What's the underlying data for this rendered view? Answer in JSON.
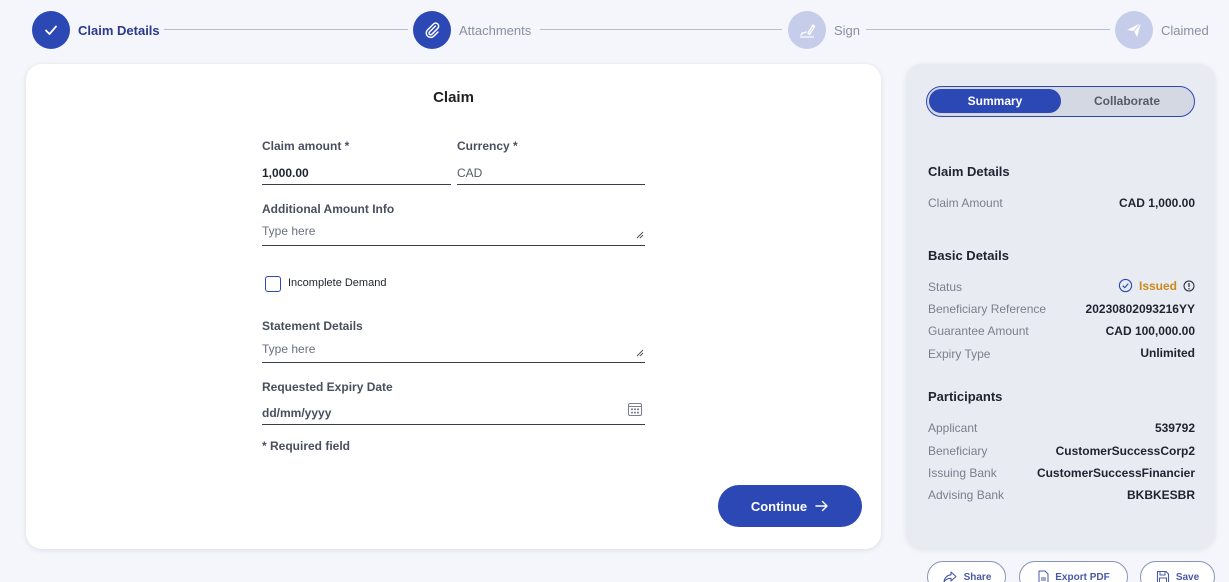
{
  "stepper": {
    "steps": [
      {
        "label": "Claim Details",
        "state": "done"
      },
      {
        "label": "Attachments",
        "state": "current"
      },
      {
        "label": "Sign",
        "state": "todo"
      },
      {
        "label": "Claimed",
        "state": "todo"
      }
    ]
  },
  "form": {
    "title": "Claim",
    "claim_amount_label": "Claim amount *",
    "claim_amount_value": "1,000.00",
    "currency_label": "Currency *",
    "currency_value": "CAD",
    "additional_info_label": "Additional Amount Info",
    "additional_info_placeholder": "Type here",
    "incomplete_demand_label": "Incomplete Demand",
    "statement_label": "Statement Details",
    "statement_placeholder": "Type here",
    "expiry_label": "Requested Expiry Date",
    "expiry_placeholder": "dd/mm/yyyy",
    "required_note": "* Required field",
    "continue_label": "Continue"
  },
  "summary": {
    "tabs": [
      "Summary",
      "Collaborate"
    ],
    "claim_details_title": "Claim Details",
    "claim_amount_label": "Claim Amount",
    "claim_amount_value": "CAD 1,000.00",
    "basic_details_title": "Basic Details",
    "status_label": "Status",
    "status_value": "Issued",
    "beneficiary_ref_label": "Beneficiary Reference",
    "beneficiary_ref_value": "20230802093216YY",
    "guarantee_amount_label": "Guarantee Amount",
    "guarantee_amount_value": "CAD 100,000.00",
    "expiry_type_label": "Expiry Type",
    "expiry_type_value": "Unlimited",
    "participants_title": "Participants",
    "applicant_label": "Applicant",
    "applicant_value": "539792",
    "beneficiary_label": "Beneficiary",
    "beneficiary_value": "CustomerSuccessCorp2",
    "issuing_bank_label": "Issuing Bank",
    "issuing_bank_value": "CustomerSuccessFinancier",
    "advising_bank_label": "Advising Bank",
    "advising_bank_value": "BKBKESBR"
  },
  "actions": {
    "share_label": "Share",
    "export_label": "Export PDF",
    "save_label": "Save"
  },
  "colors": {
    "primary": "#2b48b5",
    "issued": "#c98a1a",
    "panel_bg": "#e8ebf2"
  }
}
